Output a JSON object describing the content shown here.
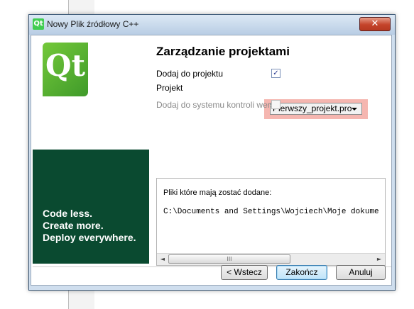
{
  "window": {
    "title": "Nowy Plik źródłowy C++",
    "icon": "qt-icon",
    "icon_glyph": "Qt",
    "close_glyph": "✕"
  },
  "logo": {
    "text": "Qt",
    "slogan": [
      "Code less.",
      "Create more.",
      "Deploy everywhere."
    ]
  },
  "page": {
    "title": "Zarządzanie projektami"
  },
  "form": {
    "add_to_project_label": "Dodaj do projektu",
    "add_to_project_checked": true,
    "add_to_project_check_glyph": "✓",
    "project_label": "Projekt",
    "project_value": "Pierwszy_projekt.pro",
    "vcs_label": "Dodaj do systemu kontroli wersji",
    "vcs_checked": false
  },
  "files": {
    "label": "Pliki które mają zostać dodane:",
    "path": "C:\\Documents and Settings\\Wojciech\\Moje dokume",
    "scroll_left": "◄",
    "scroll_right": "►",
    "scroll_thumb_grip": "III"
  },
  "buttons": {
    "back": "< Wstecz",
    "finish": "Zakończ",
    "cancel": "Anuluj"
  },
  "colors": {
    "qt_green": "#41cd52",
    "logo_panel": "#0a4a30",
    "highlight": "#f5b6b0"
  }
}
